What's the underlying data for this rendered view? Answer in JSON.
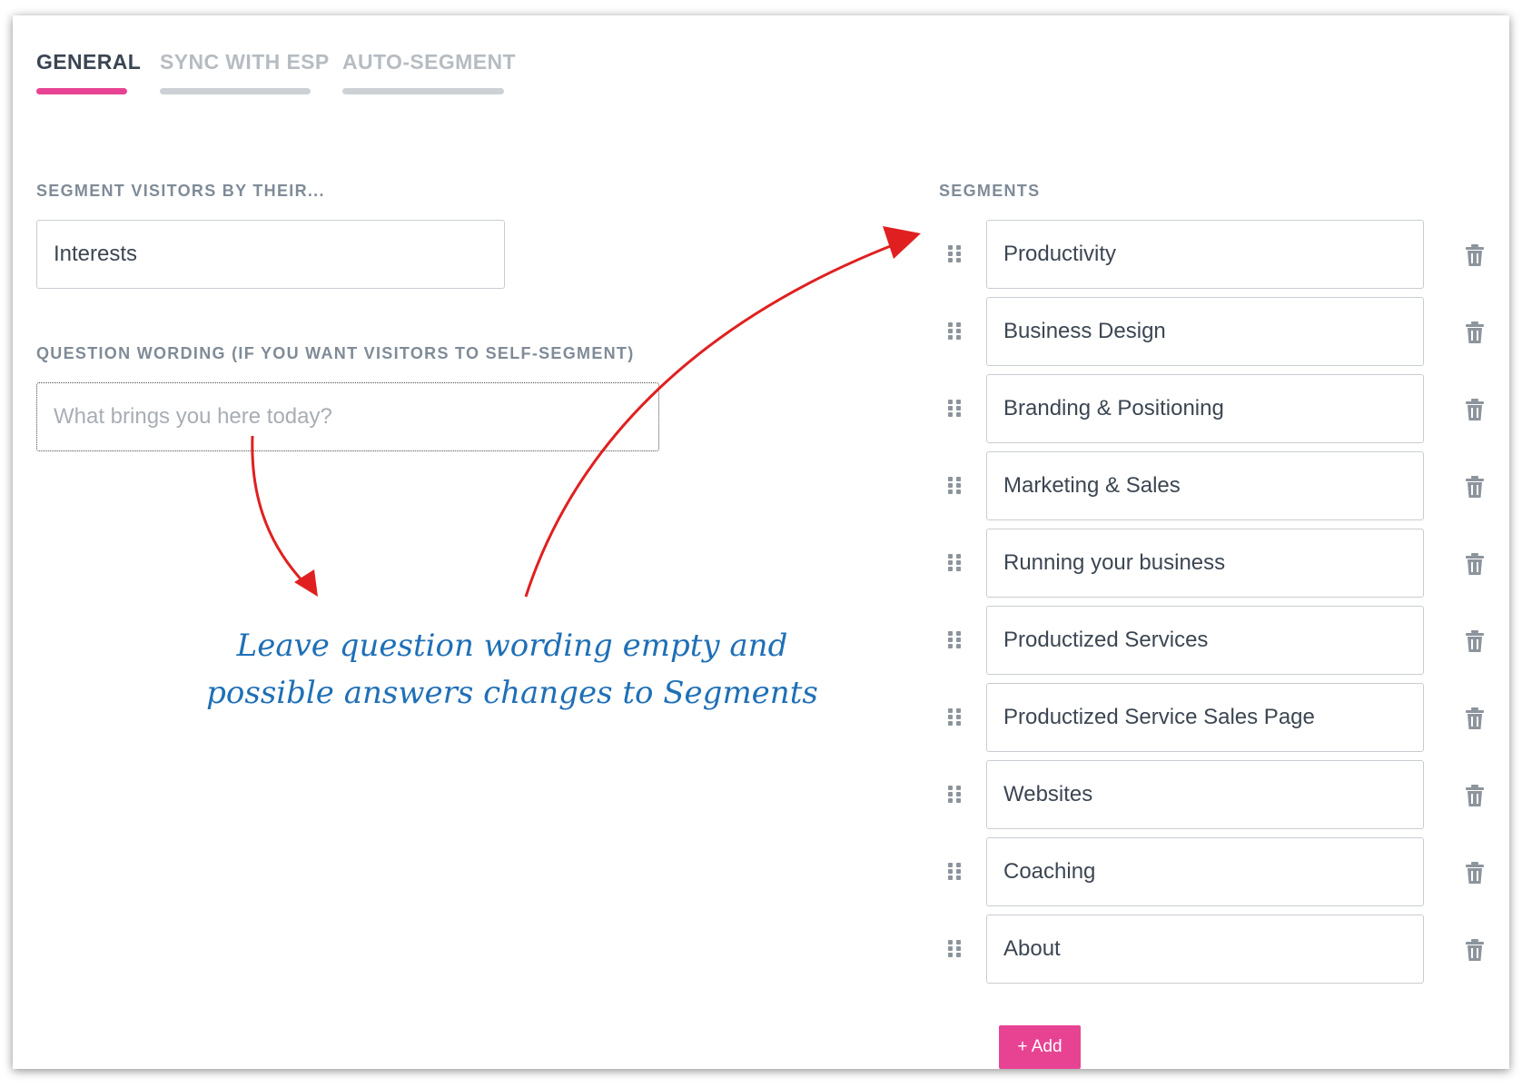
{
  "tabs": [
    {
      "label": "GENERAL",
      "active": true
    },
    {
      "label": "SYNC WITH ESP",
      "active": false
    },
    {
      "label": "AUTO-SEGMENT",
      "active": false
    }
  ],
  "segment_by": {
    "label": "SEGMENT VISITORS BY THEIR...",
    "value": "Interests"
  },
  "question": {
    "label": "QUESTION WORDING (IF YOU WANT VISITORS TO SELF-SEGMENT)",
    "placeholder": "What brings you here today?"
  },
  "segments": {
    "label": "SEGMENTS",
    "items": [
      "Productivity",
      "Business Design",
      "Branding & Positioning",
      "Marketing & Sales",
      "Running your business",
      "Productized Services",
      "Productized Service Sales Page",
      "Websites",
      "Coaching",
      "About"
    ],
    "add_label": "+ Add"
  },
  "annotation": {
    "line1": "Leave question wording empty and",
    "line2": "possible answers changes to Segments"
  },
  "colors": {
    "accent": "#e84393",
    "annotation_text": "#1f6fb6",
    "annotation_arrow": "#e02020"
  },
  "icons": {
    "drag": "drag-handle-icon",
    "delete": "trash-icon"
  }
}
